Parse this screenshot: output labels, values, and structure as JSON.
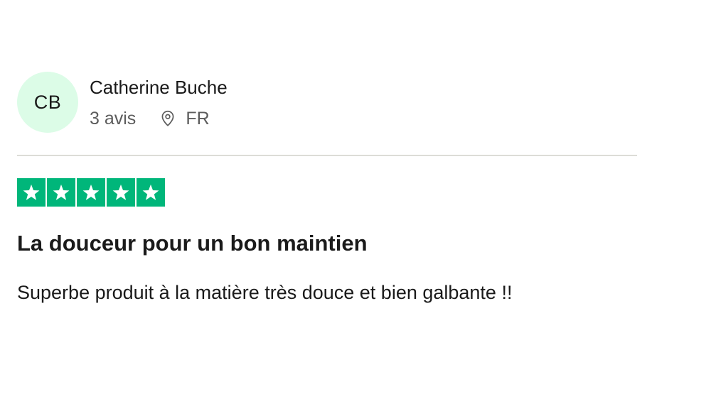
{
  "reviewer": {
    "initials": "CB",
    "name": "Catherine Buche",
    "review_count": "3 avis",
    "country": "FR",
    "avatar_bg": "#dcfce7"
  },
  "rating": {
    "stars": 5,
    "max": 5,
    "color": "#00b67a",
    "icon": "star-icon"
  },
  "review": {
    "title": "La douceur pour un bon maintien",
    "body": "Superbe produit à la matière très douce et bien galbante !!"
  }
}
